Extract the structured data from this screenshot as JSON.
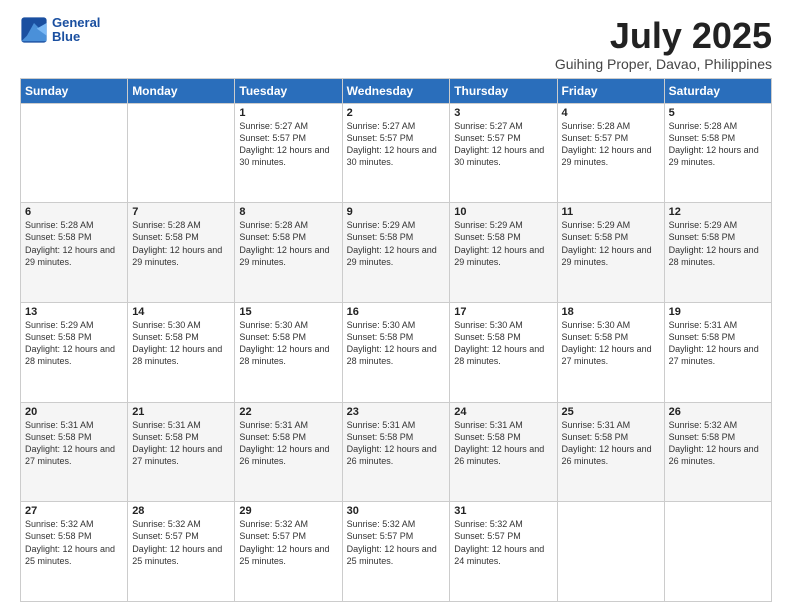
{
  "logo": {
    "line1": "General",
    "line2": "Blue"
  },
  "title": "July 2025",
  "subtitle": "Guihing Proper, Davao, Philippines",
  "days_of_week": [
    "Sunday",
    "Monday",
    "Tuesday",
    "Wednesday",
    "Thursday",
    "Friday",
    "Saturday"
  ],
  "weeks": [
    [
      {
        "day": "",
        "info": ""
      },
      {
        "day": "",
        "info": ""
      },
      {
        "day": "1",
        "info": "Sunrise: 5:27 AM\nSunset: 5:57 PM\nDaylight: 12 hours and 30 minutes."
      },
      {
        "day": "2",
        "info": "Sunrise: 5:27 AM\nSunset: 5:57 PM\nDaylight: 12 hours and 30 minutes."
      },
      {
        "day": "3",
        "info": "Sunrise: 5:27 AM\nSunset: 5:57 PM\nDaylight: 12 hours and 30 minutes."
      },
      {
        "day": "4",
        "info": "Sunrise: 5:28 AM\nSunset: 5:57 PM\nDaylight: 12 hours and 29 minutes."
      },
      {
        "day": "5",
        "info": "Sunrise: 5:28 AM\nSunset: 5:58 PM\nDaylight: 12 hours and 29 minutes."
      }
    ],
    [
      {
        "day": "6",
        "info": "Sunrise: 5:28 AM\nSunset: 5:58 PM\nDaylight: 12 hours and 29 minutes."
      },
      {
        "day": "7",
        "info": "Sunrise: 5:28 AM\nSunset: 5:58 PM\nDaylight: 12 hours and 29 minutes."
      },
      {
        "day": "8",
        "info": "Sunrise: 5:28 AM\nSunset: 5:58 PM\nDaylight: 12 hours and 29 minutes."
      },
      {
        "day": "9",
        "info": "Sunrise: 5:29 AM\nSunset: 5:58 PM\nDaylight: 12 hours and 29 minutes."
      },
      {
        "day": "10",
        "info": "Sunrise: 5:29 AM\nSunset: 5:58 PM\nDaylight: 12 hours and 29 minutes."
      },
      {
        "day": "11",
        "info": "Sunrise: 5:29 AM\nSunset: 5:58 PM\nDaylight: 12 hours and 29 minutes."
      },
      {
        "day": "12",
        "info": "Sunrise: 5:29 AM\nSunset: 5:58 PM\nDaylight: 12 hours and 28 minutes."
      }
    ],
    [
      {
        "day": "13",
        "info": "Sunrise: 5:29 AM\nSunset: 5:58 PM\nDaylight: 12 hours and 28 minutes."
      },
      {
        "day": "14",
        "info": "Sunrise: 5:30 AM\nSunset: 5:58 PM\nDaylight: 12 hours and 28 minutes."
      },
      {
        "day": "15",
        "info": "Sunrise: 5:30 AM\nSunset: 5:58 PM\nDaylight: 12 hours and 28 minutes."
      },
      {
        "day": "16",
        "info": "Sunrise: 5:30 AM\nSunset: 5:58 PM\nDaylight: 12 hours and 28 minutes."
      },
      {
        "day": "17",
        "info": "Sunrise: 5:30 AM\nSunset: 5:58 PM\nDaylight: 12 hours and 28 minutes."
      },
      {
        "day": "18",
        "info": "Sunrise: 5:30 AM\nSunset: 5:58 PM\nDaylight: 12 hours and 27 minutes."
      },
      {
        "day": "19",
        "info": "Sunrise: 5:31 AM\nSunset: 5:58 PM\nDaylight: 12 hours and 27 minutes."
      }
    ],
    [
      {
        "day": "20",
        "info": "Sunrise: 5:31 AM\nSunset: 5:58 PM\nDaylight: 12 hours and 27 minutes."
      },
      {
        "day": "21",
        "info": "Sunrise: 5:31 AM\nSunset: 5:58 PM\nDaylight: 12 hours and 27 minutes."
      },
      {
        "day": "22",
        "info": "Sunrise: 5:31 AM\nSunset: 5:58 PM\nDaylight: 12 hours and 26 minutes."
      },
      {
        "day": "23",
        "info": "Sunrise: 5:31 AM\nSunset: 5:58 PM\nDaylight: 12 hours and 26 minutes."
      },
      {
        "day": "24",
        "info": "Sunrise: 5:31 AM\nSunset: 5:58 PM\nDaylight: 12 hours and 26 minutes."
      },
      {
        "day": "25",
        "info": "Sunrise: 5:31 AM\nSunset: 5:58 PM\nDaylight: 12 hours and 26 minutes."
      },
      {
        "day": "26",
        "info": "Sunrise: 5:32 AM\nSunset: 5:58 PM\nDaylight: 12 hours and 26 minutes."
      }
    ],
    [
      {
        "day": "27",
        "info": "Sunrise: 5:32 AM\nSunset: 5:58 PM\nDaylight: 12 hours and 25 minutes."
      },
      {
        "day": "28",
        "info": "Sunrise: 5:32 AM\nSunset: 5:57 PM\nDaylight: 12 hours and 25 minutes."
      },
      {
        "day": "29",
        "info": "Sunrise: 5:32 AM\nSunset: 5:57 PM\nDaylight: 12 hours and 25 minutes."
      },
      {
        "day": "30",
        "info": "Sunrise: 5:32 AM\nSunset: 5:57 PM\nDaylight: 12 hours and 25 minutes."
      },
      {
        "day": "31",
        "info": "Sunrise: 5:32 AM\nSunset: 5:57 PM\nDaylight: 12 hours and 24 minutes."
      },
      {
        "day": "",
        "info": ""
      },
      {
        "day": "",
        "info": ""
      }
    ]
  ]
}
